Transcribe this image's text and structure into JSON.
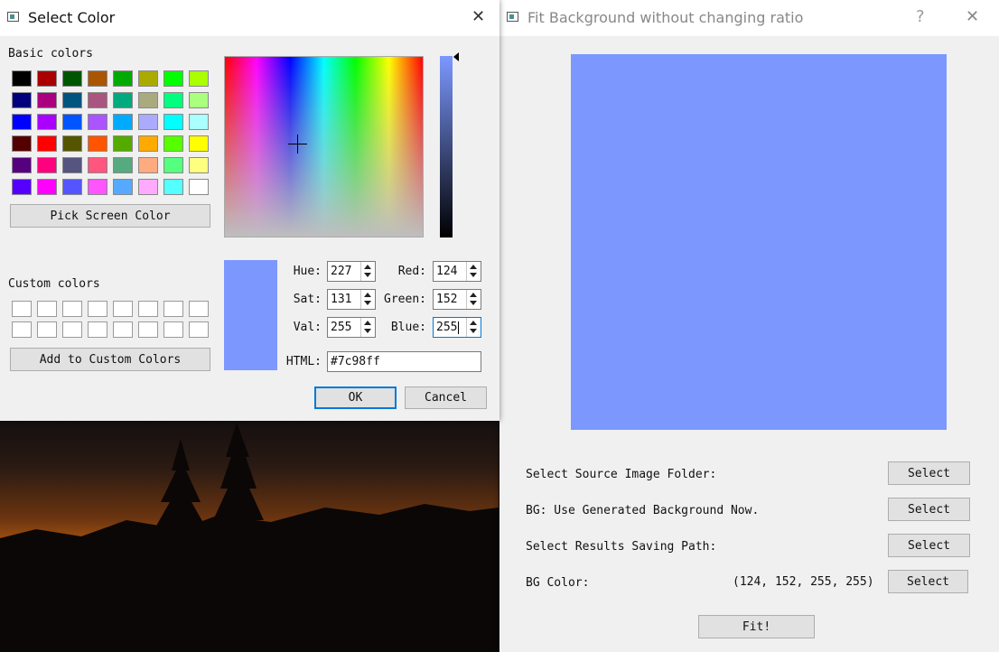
{
  "select_color_dialog": {
    "title": "Select Color",
    "basic_colors_label": "Basic colors",
    "basic_colors": [
      "#000000",
      "#aa0000",
      "#005500",
      "#aa5500",
      "#00aa00",
      "#aaaa00",
      "#00ff00",
      "#aaff00",
      "#00007f",
      "#aa007f",
      "#00557f",
      "#aa557f",
      "#00aa7f",
      "#aaaa7f",
      "#00ff7f",
      "#aaff7f",
      "#0000ff",
      "#aa00ff",
      "#0055ff",
      "#aa55ff",
      "#00aaff",
      "#aaaaff",
      "#00ffff",
      "#aaffff",
      "#550000",
      "#ff0000",
      "#555500",
      "#ff5500",
      "#55aa00",
      "#ffaa00",
      "#55ff00",
      "#ffff00",
      "#55007f",
      "#ff007f",
      "#55557f",
      "#ff557f",
      "#55aa7f",
      "#ffaa7f",
      "#55ff7f",
      "#ffff7f",
      "#5500ff",
      "#ff00ff",
      "#5555ff",
      "#ff55ff",
      "#55aaff",
      "#ffaaff",
      "#55ffff",
      "#ffffff"
    ],
    "pick_screen_color_label": "Pick Screen Color",
    "custom_colors_label": "Custom colors",
    "add_custom_label": "Add to Custom Colors",
    "current_color": "#7c98ff",
    "fields": {
      "hue_label": "Hue:",
      "hue": "227",
      "sat_label": "Sat:",
      "sat": "131",
      "val_label": "Val:",
      "val": "255",
      "red_label": "Red:",
      "red": "124",
      "green_label": "Green:",
      "green": "152",
      "blue_label": "Blue:",
      "blue": "255",
      "html_label": "HTML:",
      "html": "#7c98ff"
    },
    "ok_label": "OK",
    "cancel_label": "Cancel"
  },
  "fit_window": {
    "title": "Fit Background without changing ratio",
    "help_icon": "?",
    "close_icon": "✕",
    "preview_color": "#7c98ff",
    "rows": [
      {
        "label": "Select Source Image Folder:",
        "button": "Select"
      },
      {
        "label": "BG: Use Generated Background Now.",
        "button": "Select"
      },
      {
        "label": "Select Results Saving Path:",
        "button": "Select"
      },
      {
        "label": "BG Color:",
        "value": "(124, 152, 255, 255)",
        "button": "Select"
      }
    ],
    "fit_label": "Fit!"
  }
}
